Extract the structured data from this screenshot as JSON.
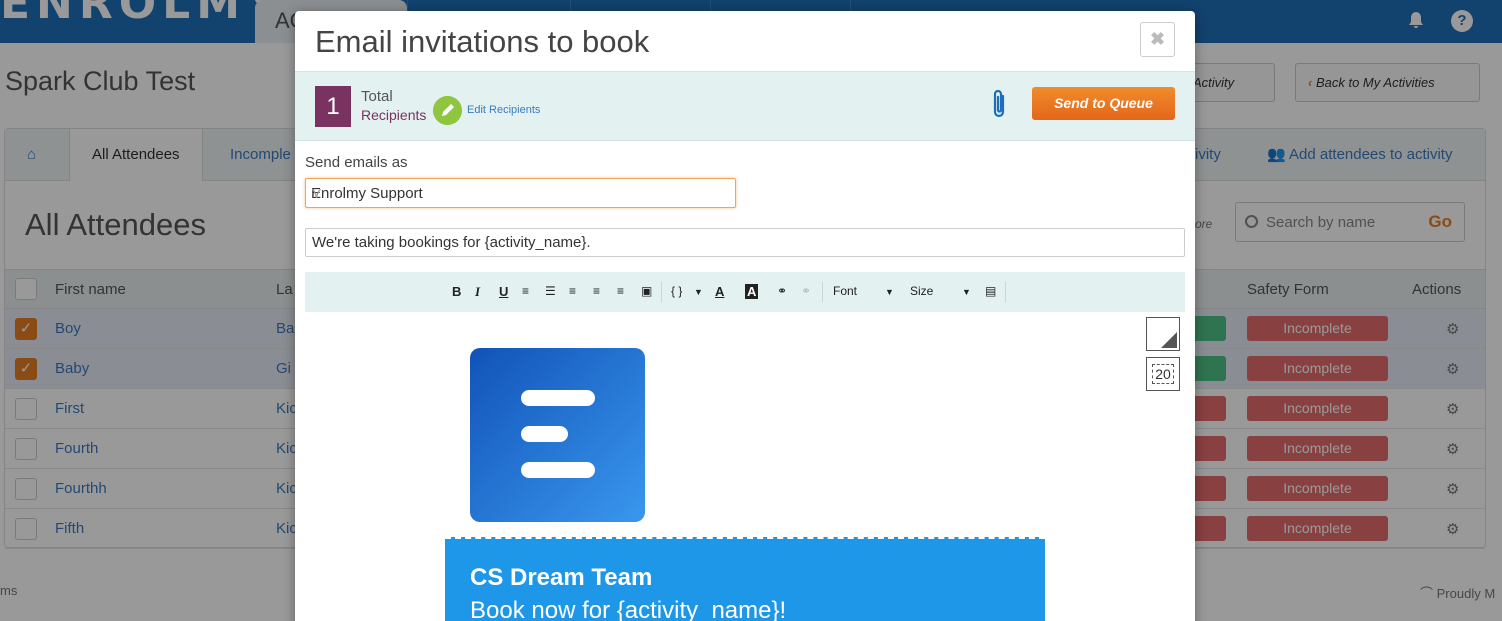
{
  "background": {
    "logo_text": "ENROLMY",
    "nav_active_tab": "AC",
    "page_title": "Spark Club Test",
    "buttons": {
      "activity_partial": "Activity",
      "back": "Back to My Activities"
    },
    "tabs": {
      "home_icon": "home-icon",
      "all_attendees": "All Attendees",
      "incomplete_partial": "Incomple",
      "activity_partial": "ivity",
      "add_attendees": "Add attendees to activity"
    },
    "section_title": "All Attendees",
    "more_partial": "ore",
    "search": {
      "placeholder": "Search by name",
      "go": "Go"
    },
    "table": {
      "headers": {
        "first_name": "First name",
        "last_name_partial": "La",
        "safety_form": "Safety Form",
        "actions": "Actions"
      },
      "rows": [
        {
          "first": "Boy",
          "last": "Ba",
          "checked": true,
          "status": "Incomplete",
          "side": "green"
        },
        {
          "first": "Baby",
          "last": "Gi",
          "checked": true,
          "status": "Incomplete",
          "side": "green"
        },
        {
          "first": "First",
          "last": "Kic",
          "checked": false,
          "status": "Incomplete",
          "side": "red"
        },
        {
          "first": "Fourth",
          "last": "Kic",
          "checked": false,
          "status": "Incomplete",
          "side": "red"
        },
        {
          "first": "Fourthh",
          "last": "Kic",
          "checked": false,
          "status": "Incomplete",
          "side": "red"
        },
        {
          "first": "Fifth",
          "last": "Kic",
          "checked": false,
          "status": "Incomplete",
          "side": "red"
        }
      ]
    },
    "footer_left": "ms",
    "footer_right": "Proudly M"
  },
  "modal": {
    "title": "Email invitations to book",
    "close_label": "✖",
    "recipients": {
      "count": "1",
      "total_label": "Total",
      "recipients_label": "Recipients",
      "edit_label": "Edit Recipients"
    },
    "send_button": "Send to Queue",
    "send_as_label": "Send emails as",
    "send_as_value": "Enrolmy Support",
    "subject": "We're taking bookings for {activity_name}.",
    "toolbar": {
      "bold": "B",
      "italic": "I",
      "underline": "U",
      "code": "{ }",
      "font_color": "A",
      "bg_color": "A",
      "font_label": "Font",
      "size_label": "Size"
    },
    "side_number": "20",
    "email_body": {
      "banner_title": "CS Dream Team",
      "banner_subtitle": "Book now for {activity_name}!"
    }
  },
  "colors": {
    "nav_blue": "#1f6fb8",
    "accent_orange": "#e67e22",
    "recipient_purple": "#7a3261",
    "status_red": "#e46b6b",
    "status_green": "#4fc185",
    "banner_blue": "#1e97e9"
  }
}
